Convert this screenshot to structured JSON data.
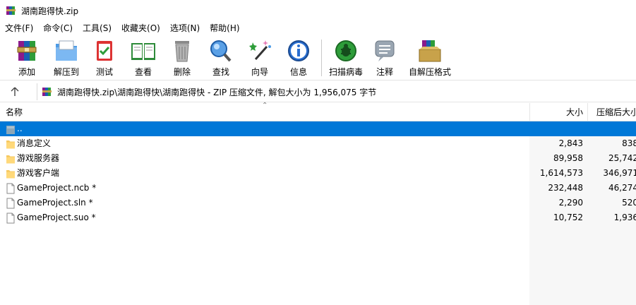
{
  "window": {
    "title": "湖南跑得快.zip"
  },
  "menu": [
    "文件(F)",
    "命令(C)",
    "工具(S)",
    "收藏夹(O)",
    "选项(N)",
    "帮助(H)"
  ],
  "toolbar": {
    "add": "添加",
    "extract": "解压到",
    "test": "测试",
    "view": "查看",
    "delete": "删除",
    "find": "查找",
    "wizard": "向导",
    "info": "信息",
    "scan": "扫描病毒",
    "comment": "注释",
    "sfx": "自解压格式"
  },
  "address": {
    "text": "湖南跑得快.zip\\湖南跑得快\\湖南跑得快 - ZIP 压缩文件, 解包大小为 1,956,075 字节"
  },
  "columns": {
    "name": "名称",
    "size": "大小",
    "packed": "压缩后大小"
  },
  "files": [
    {
      "name": "..",
      "size": "",
      "packed": "",
      "type": "up",
      "selected": true
    },
    {
      "name": "消息定义",
      "size": "2,843",
      "packed": "838",
      "type": "folder",
      "selected": false
    },
    {
      "name": "游戏服务器",
      "size": "89,958",
      "packed": "25,742",
      "type": "folder",
      "selected": false
    },
    {
      "name": "游戏客户端",
      "size": "1,614,573",
      "packed": "346,971",
      "type": "folder",
      "selected": false
    },
    {
      "name": "GameProject.ncb *",
      "size": "232,448",
      "packed": "46,274",
      "type": "file",
      "selected": false
    },
    {
      "name": "GameProject.sln *",
      "size": "2,290",
      "packed": "520",
      "type": "file",
      "selected": false
    },
    {
      "name": "GameProject.suo *",
      "size": "10,752",
      "packed": "1,936",
      "type": "file",
      "selected": false
    }
  ],
  "colors": {
    "selection": "#0078d7",
    "folder": "#f6c85f"
  }
}
